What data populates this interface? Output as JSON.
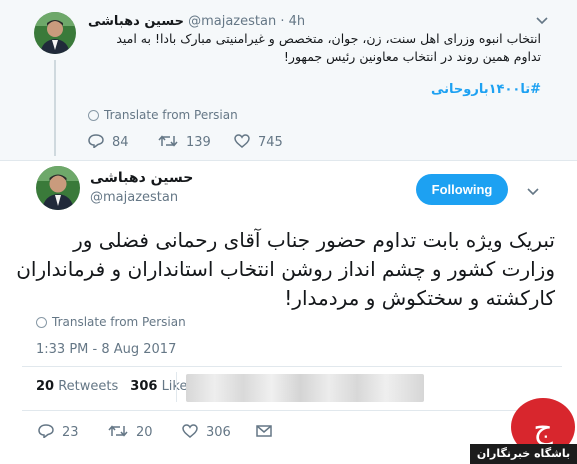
{
  "reply_tweet": {
    "author_name": "حسین دهباشی",
    "handle": "@majazestan",
    "time": "4h",
    "body": "انتخاب انبوه وزرای اهل سنت، زن، جوان، متخصص و غیرامنیتی مبارک بادا! به امید تداوم همین روند در انتخاب معاونین رئیس جمهور!",
    "hashtag": "#تا۱۴۰۰باروحانی",
    "translate_label": "Translate from Persian",
    "replies": "84",
    "retweets": "139",
    "likes": "745"
  },
  "main_tweet": {
    "author_name": "حسین دهباشی",
    "handle": "@majazestan",
    "follow_label": "Following",
    "body": "تبریک ویژه بابت تداوم حضور جناب آقای رحمانی فضلی ور وزارت کشور و چشم انداز روشن انتخاب استانداران و فرمانداران کارکشته و سختکوش و مردمدار!",
    "translate_label": "Translate from Persian",
    "timestamp": "1:33 PM - 8 Aug 2017",
    "retweet_count": "20",
    "retweet_word": "Retweets",
    "like_count": "306",
    "like_word": "Likes",
    "replies": "23",
    "retweets": "20",
    "likes": "306"
  },
  "watermark": {
    "text": "باشگاه خبرنگاران"
  },
  "colors": {
    "accent": "#1da1f2",
    "muted": "#657786",
    "watermark_red": "#d8262d"
  },
  "icons": [
    "reply-icon",
    "retweet-icon",
    "like-icon",
    "message-icon",
    "chevron-down-icon",
    "globe-icon"
  ]
}
